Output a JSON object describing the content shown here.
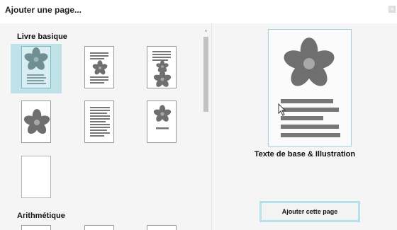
{
  "window": {
    "title": "Ajouter une page...",
    "close_icon": "×"
  },
  "categories": [
    {
      "label": "Livre basique"
    },
    {
      "label": "Arithmétique"
    }
  ],
  "templates": [
    {
      "name": "text-and-illustration",
      "selected": true
    },
    {
      "name": "text-illustration-text",
      "selected": false
    },
    {
      "name": "text-and-two-illustrations",
      "selected": false
    },
    {
      "name": "illustration-only",
      "selected": false
    },
    {
      "name": "text-only",
      "selected": false
    },
    {
      "name": "illustration-and-caption",
      "selected": false
    },
    {
      "name": "blank",
      "selected": false
    }
  ],
  "preview": {
    "caption": "Texte de base & Illustration"
  },
  "actions": {
    "add_page_label": "Ajouter cette page"
  },
  "colors": {
    "selection": "#bfe2e8",
    "flower": "#6f6f6f",
    "flower_center": "#a8a8a8",
    "text_lines": "#777777",
    "button_border": "#b7e1ea"
  },
  "icons": {
    "flower": "flower-illustration-icon",
    "scroll_up": "chevron-up-icon",
    "close": "close-icon",
    "cursor": "mouse-cursor-icon"
  }
}
